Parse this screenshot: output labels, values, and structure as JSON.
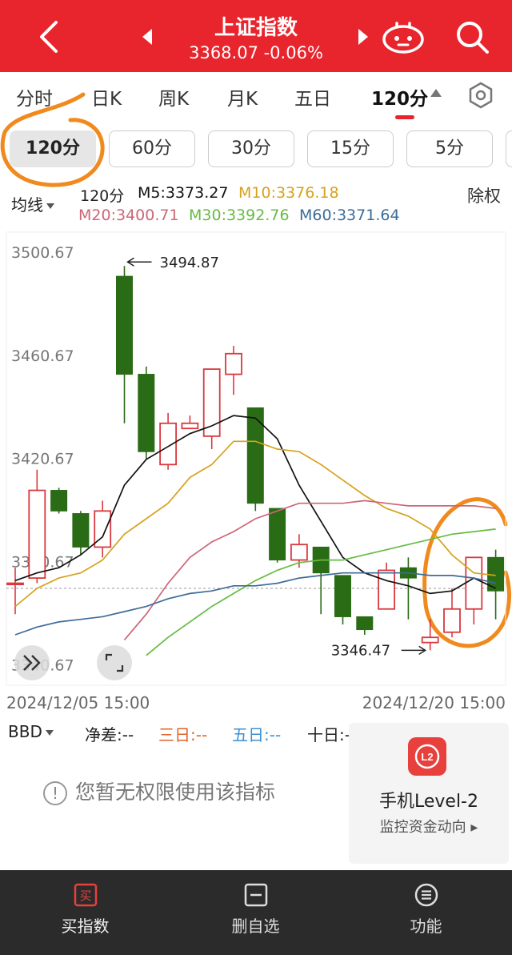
{
  "header": {
    "title": "上证指数",
    "subtitle": "3368.07 -0.06%"
  },
  "tabs": [
    {
      "label": "分时"
    },
    {
      "label": "日K"
    },
    {
      "label": "周K"
    },
    {
      "label": "月K"
    },
    {
      "label": "五日"
    },
    {
      "label": "120分",
      "active": true
    }
  ],
  "sub_periods": [
    {
      "label": "120分",
      "active": true
    },
    {
      "label": "60分"
    },
    {
      "label": "30分"
    },
    {
      "label": "15分"
    },
    {
      "label": "5分"
    }
  ],
  "legend": {
    "ma_button": "均线",
    "period": "120分",
    "m5": "M5:3373.27",
    "m10": "M10:3376.18",
    "m20": "M20:3400.71",
    "m30": "M30:3392.76",
    "m60": "M60:3371.64",
    "right_label": "除权"
  },
  "colors": {
    "header_red": "#e8242c",
    "up_candle": "#d9393f",
    "down_candle": "#2a6b16",
    "m5": "#111111",
    "m10": "#d6a21e",
    "m20": "#cc6677",
    "m30": "#66bb44",
    "m60": "#3b6c9a",
    "annotation_orange": "#f08a1e"
  },
  "chart_data": {
    "type": "candlestick",
    "y_ticks": [
      "3500.67",
      "3460.67",
      "3420.67",
      "3380.67",
      "3340.67"
    ],
    "ylim": [
      3334,
      3505
    ],
    "high_label": "3494.87",
    "low_label": "3346.47",
    "x_start_label": "2024/12/05 15:00",
    "x_end_label": "2024/12/20 15:00",
    "reference_price": 3370.0,
    "candles": [
      {
        "open": 3372,
        "close": 3372,
        "high": 3378,
        "low": 3360
      },
      {
        "open": 3374,
        "close": 3408,
        "high": 3416,
        "low": 3372
      },
      {
        "open": 3408,
        "close": 3400,
        "high": 3409,
        "low": 3399
      },
      {
        "open": 3399,
        "close": 3386,
        "high": 3400,
        "low": 3383
      },
      {
        "open": 3386,
        "close": 3400,
        "high": 3404,
        "low": 3382
      },
      {
        "open": 3491,
        "close": 3453,
        "high": 3495,
        "low": 3434
      },
      {
        "open": 3453,
        "close": 3423,
        "high": 3456,
        "low": 3420
      },
      {
        "open": 3418,
        "close": 3434,
        "high": 3438,
        "low": 3416
      },
      {
        "open": 3432,
        "close": 3434,
        "high": 3437,
        "low": 3432
      },
      {
        "open": 3429,
        "close": 3455,
        "high": 3455,
        "low": 3424
      },
      {
        "open": 3453,
        "close": 3461,
        "high": 3464,
        "low": 3445
      },
      {
        "open": 3440,
        "close": 3403,
        "high": 3440,
        "low": 3400
      },
      {
        "open": 3401,
        "close": 3381,
        "high": 3401,
        "low": 3380
      },
      {
        "open": 3381,
        "close": 3387,
        "high": 3391,
        "low": 3378
      },
      {
        "open": 3386,
        "close": 3376,
        "high": 3386,
        "low": 3360
      },
      {
        "open": 3375,
        "close": 3359,
        "high": 3375,
        "low": 3356
      },
      {
        "open": 3359,
        "close": 3354,
        "high": 3359,
        "low": 3352
      },
      {
        "open": 3362,
        "close": 3377,
        "high": 3380,
        "low": 3362
      },
      {
        "open": 3378,
        "close": 3374,
        "high": 3382,
        "low": 3358
      },
      {
        "open": 3349,
        "close": 3351,
        "high": 3358,
        "low": 3346
      },
      {
        "open": 3353,
        "close": 3362,
        "high": 3370,
        "low": 3351
      },
      {
        "open": 3362,
        "close": 3382,
        "high": 3382,
        "low": 3356
      },
      {
        "open": 3382,
        "close": 3369,
        "high": 3385,
        "low": 3358
      }
    ],
    "series": [
      {
        "name": "M5",
        "values": [
          3373,
          3376,
          3378,
          3383,
          3390,
          3410,
          3420,
          3425,
          3430,
          3433,
          3437,
          3436,
          3428,
          3410,
          3396,
          3382,
          3376,
          3373,
          3371,
          3368,
          3369,
          3374,
          3370
        ]
      },
      {
        "name": "M10",
        "values": [
          3363,
          3370,
          3374,
          3376,
          3381,
          3391,
          3397,
          3403,
          3413,
          3418,
          3427,
          3427,
          3424,
          3423,
          3418,
          3412,
          3406,
          3401,
          3398,
          3393,
          3383,
          3376,
          3375
        ]
      },
      {
        "name": "M20",
        "values": [
          null,
          null,
          null,
          null,
          null,
          3350,
          3360,
          3372,
          3382,
          3388,
          3392,
          3397,
          3400,
          3403,
          3403,
          3403,
          3404,
          3403,
          3402,
          3402,
          3402,
          3402,
          3401
        ]
      },
      {
        "name": "M30",
        "values": [
          null,
          null,
          null,
          null,
          null,
          null,
          3344,
          3351,
          3357,
          3363,
          3368,
          3373,
          3377,
          3380,
          3381,
          3381,
          3383,
          3385,
          3387,
          3389,
          3391,
          3392,
          3393
        ]
      },
      {
        "name": "M60",
        "values": [
          3352,
          3355,
          3357,
          3358,
          3359,
          3361,
          3363,
          3366,
          3368,
          3369,
          3371,
          3371,
          3372,
          3374,
          3375,
          3376,
          3376,
          3376,
          3376,
          3375,
          3375,
          3374,
          3372
        ]
      }
    ]
  },
  "bbd": {
    "label": "BBD",
    "net": "净差:--",
    "three_day": "三日:--",
    "five_day": "五日:--",
    "ten_day": "十日:--"
  },
  "no_permission": "您暂无权限使用该指标",
  "level2": {
    "logo": "L2",
    "title": "手机Level-2",
    "subtitle": "监控资金动向 ▸"
  },
  "bottom_nav": [
    {
      "label": "买指数",
      "icon": "buy-icon",
      "glyph": "买"
    },
    {
      "label": "删自选",
      "icon": "remove-watchlist-icon"
    },
    {
      "label": "功能",
      "icon": "menu-icon"
    }
  ]
}
